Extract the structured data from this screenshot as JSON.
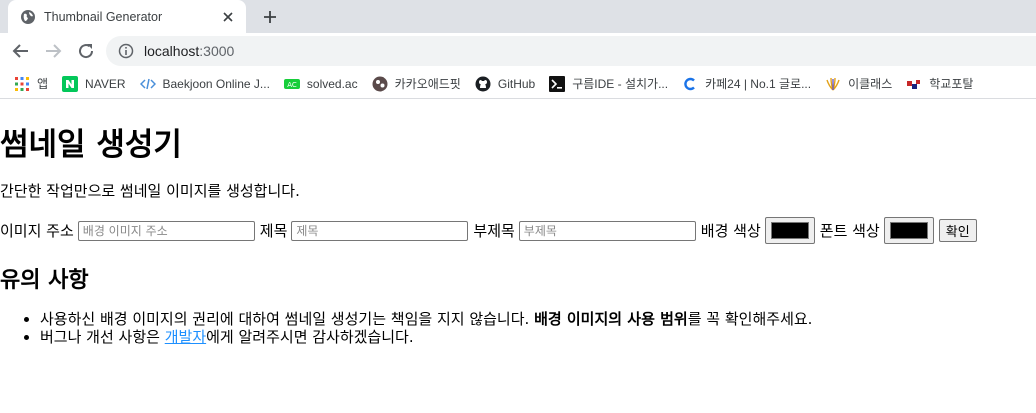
{
  "browser": {
    "tab_title": "Thumbnail Generator",
    "url_host": "localhost",
    "url_port": ":3000"
  },
  "bookmarks": [
    {
      "label": "앱",
      "icon": "apps-grid-icon"
    },
    {
      "label": "NAVER",
      "icon": "naver-icon"
    },
    {
      "label": "Baekjoon Online J...",
      "icon": "baekjoon-icon"
    },
    {
      "label": "solved.ac",
      "icon": "solvedac-icon"
    },
    {
      "label": "카카오애드핏",
      "icon": "kakao-adfit-icon"
    },
    {
      "label": "GitHub",
      "icon": "github-icon"
    },
    {
      "label": "구름IDE - 설치가...",
      "icon": "goorm-ide-icon"
    },
    {
      "label": "카페24 | No.1 글로...",
      "icon": "cafe24-icon"
    },
    {
      "label": "이클래스",
      "icon": "eclass-icon"
    },
    {
      "label": "학교포탈",
      "icon": "school-portal-icon"
    }
  ],
  "page": {
    "title": "썸네일 생성기",
    "description": "간단한 작업만으로 썸네일 이미지를 생성합니다.",
    "form": {
      "image_url_label": "이미지 주소",
      "image_url_placeholder": "배경 이미지 주소",
      "title_label": "제목",
      "title_placeholder": "제목",
      "subtitle_label": "부제목",
      "subtitle_placeholder": "부제목",
      "bg_color_label": "배경 색상",
      "bg_color_value": "#000000",
      "font_color_label": "폰트 색상",
      "font_color_value": "#000000",
      "confirm_label": "확인"
    },
    "notes_heading": "유의 사항",
    "notes": {
      "note1_before": "사용하신 배경 이미지의 권리에 대하여 썸네일 생성기는 책임을 지지 않습니다. ",
      "note1_bold": "배경 이미지의 사용 범위",
      "note1_after": "를 꼭 확인해주세요.",
      "note2_before": "버그나 개선 사항은 ",
      "note2_link": "개발자",
      "note2_after": "에게 알려주시면 감사하겠습니다."
    }
  }
}
